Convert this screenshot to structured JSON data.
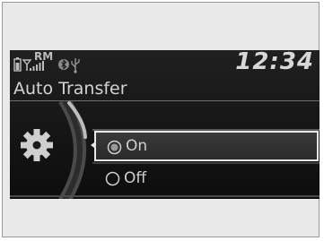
{
  "status": {
    "icons": [
      "phone-battery-icon",
      "signal-strength-icon",
      "roaming-indicator",
      "bluetooth-icon",
      "usb-icon"
    ],
    "roaming_label": "RM",
    "time": "12:34"
  },
  "title": "Auto Transfer",
  "section_icon": "gear-icon",
  "options": [
    {
      "label": "On",
      "selected": true
    },
    {
      "label": "Off",
      "selected": false
    }
  ],
  "colors": {
    "screen_bg": "#141414",
    "text": "#d4d4d4",
    "highlight_border": "#e8e8e8"
  }
}
